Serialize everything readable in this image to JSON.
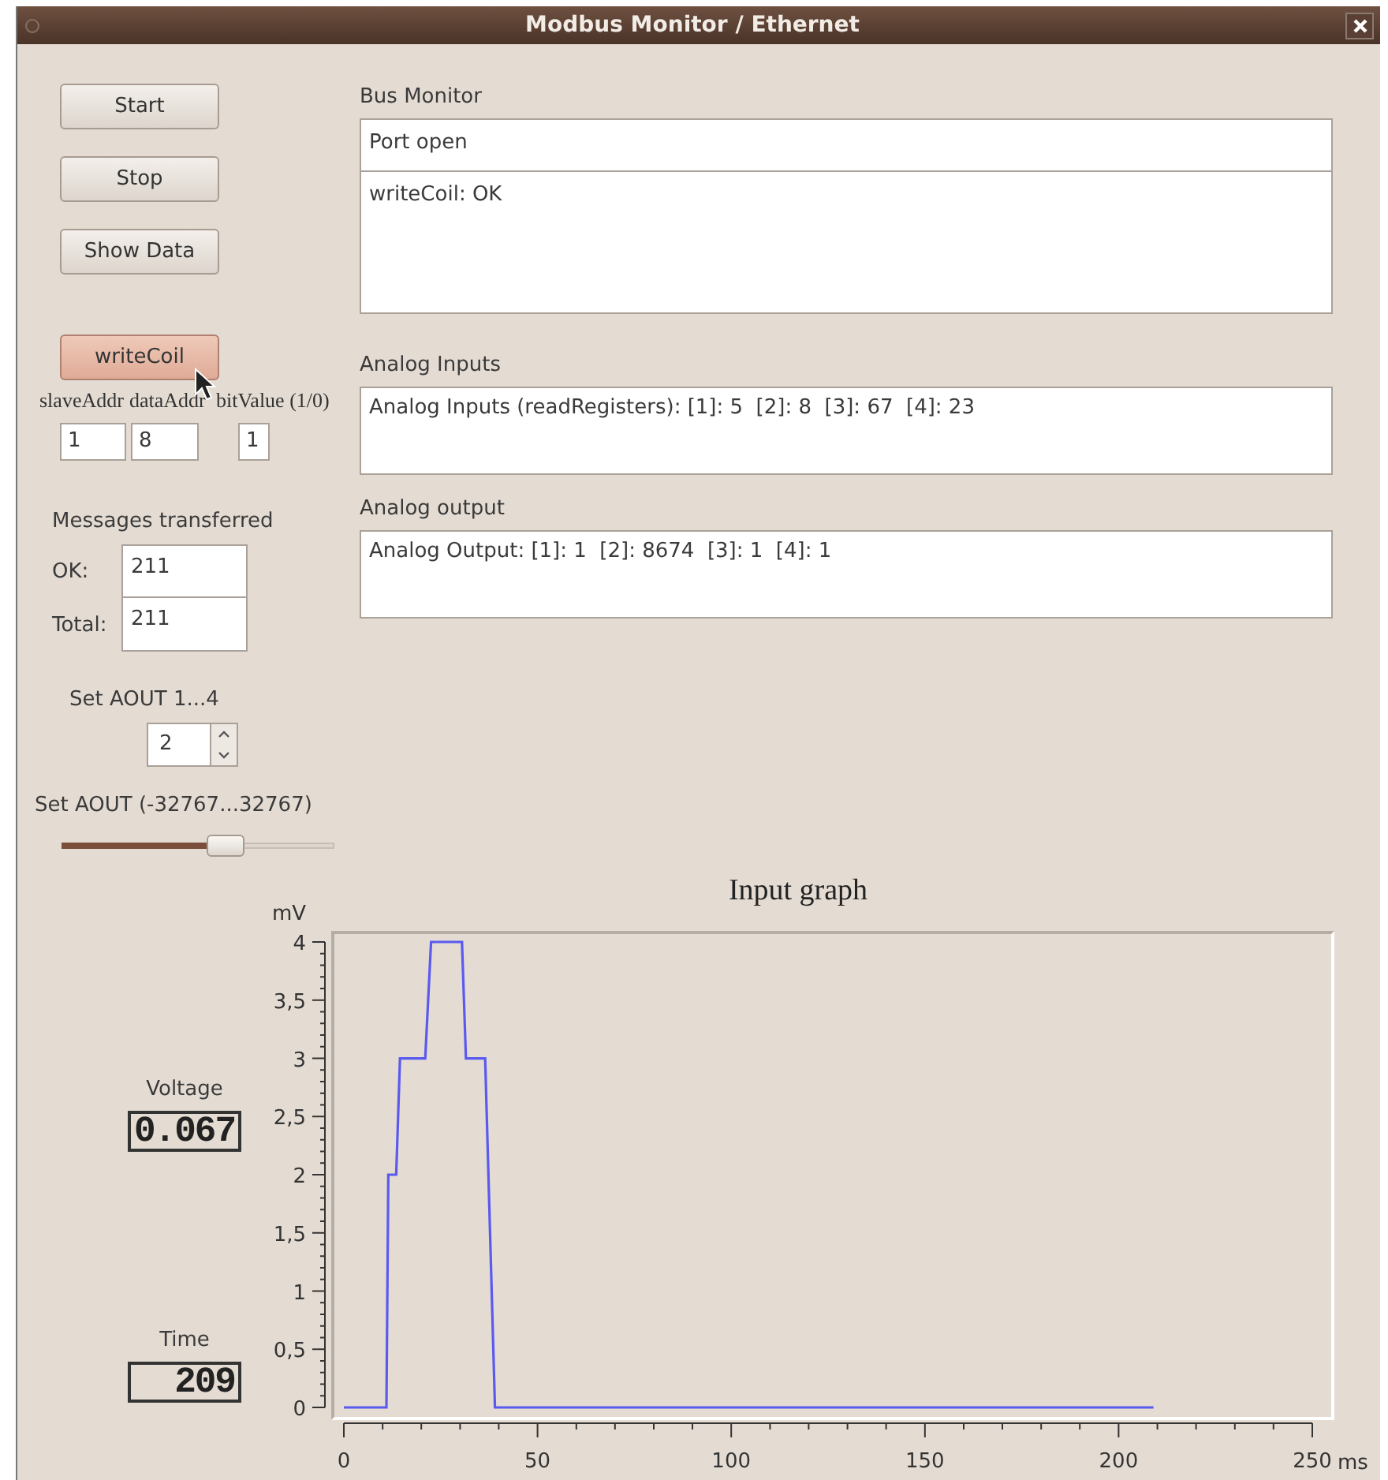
{
  "window": {
    "title": "Modbus Monitor / Ethernet"
  },
  "controls": {
    "buttons": [
      "Start",
      "Stop",
      "Show Data"
    ],
    "write_coil": {
      "label": "writeCoil",
      "hovered": true
    },
    "fields": [
      {
        "label": "slaveAddr",
        "value": "1"
      },
      {
        "label": "dataAddr",
        "value": "8"
      },
      {
        "label": "bitValue (1/0)",
        "value": "1"
      }
    ],
    "messages": {
      "title": "Messages transferred",
      "rows": [
        {
          "label": "OK:",
          "value": "211"
        },
        {
          "label": "Total:",
          "value": "211"
        }
      ]
    },
    "aout_select": {
      "label": "Set AOUT 1...4",
      "value": "2"
    },
    "aout_slider": {
      "label": "Set AOUT (-32767...32767)",
      "level": 0.6
    }
  },
  "monitor": [
    {
      "title": "Bus Monitor",
      "boxes": [
        {
          "kind": "line",
          "text": "Port open"
        },
        {
          "kind": "log",
          "text": "writeCoil: OK"
        }
      ]
    },
    {
      "title": "Analog Inputs",
      "boxes": [
        {
          "kind": "block",
          "text": "Analog Inputs (readRegisters): [1]: 5  [2]: 8  [3]: 67  [4]: 23"
        }
      ]
    },
    {
      "title": "Analog output",
      "boxes": [
        {
          "kind": "block",
          "text": "Analog Output: [1]: 1  [2]: 8674  [3]: 1  [4]: 1"
        }
      ]
    }
  ],
  "readouts": [
    {
      "label": "Voltage",
      "value": "0.067"
    },
    {
      "label": "Time",
      "value": "209"
    }
  ],
  "graph": {
    "chart_data": {
      "type": "line",
      "title": "Input graph",
      "xlabel": "ms",
      "ylabel": "mV",
      "x": [
        0,
        11,
        11.5,
        13.5,
        14.5,
        21,
        22.5,
        30.5,
        31.5,
        36.5,
        39,
        209
      ],
      "series": [
        {
          "color": "#5a5af0",
          "values": [
            0,
            0,
            2,
            2,
            3,
            3,
            4,
            4,
            3,
            3,
            0,
            0
          ]
        }
      ],
      "xlim": [
        0,
        250
      ],
      "ylim": [
        0,
        4
      ],
      "xticks": [
        0,
        50,
        100,
        150,
        200,
        250
      ],
      "yticks": [
        0,
        {
          "value": 0.5,
          "label": "0,5"
        },
        1,
        {
          "value": 1.5,
          "label": "1,5"
        },
        2,
        {
          "value": 2.5,
          "label": "2,5"
        },
        3,
        {
          "value": 3.5,
          "label": "3,5"
        },
        4
      ]
    }
  }
}
